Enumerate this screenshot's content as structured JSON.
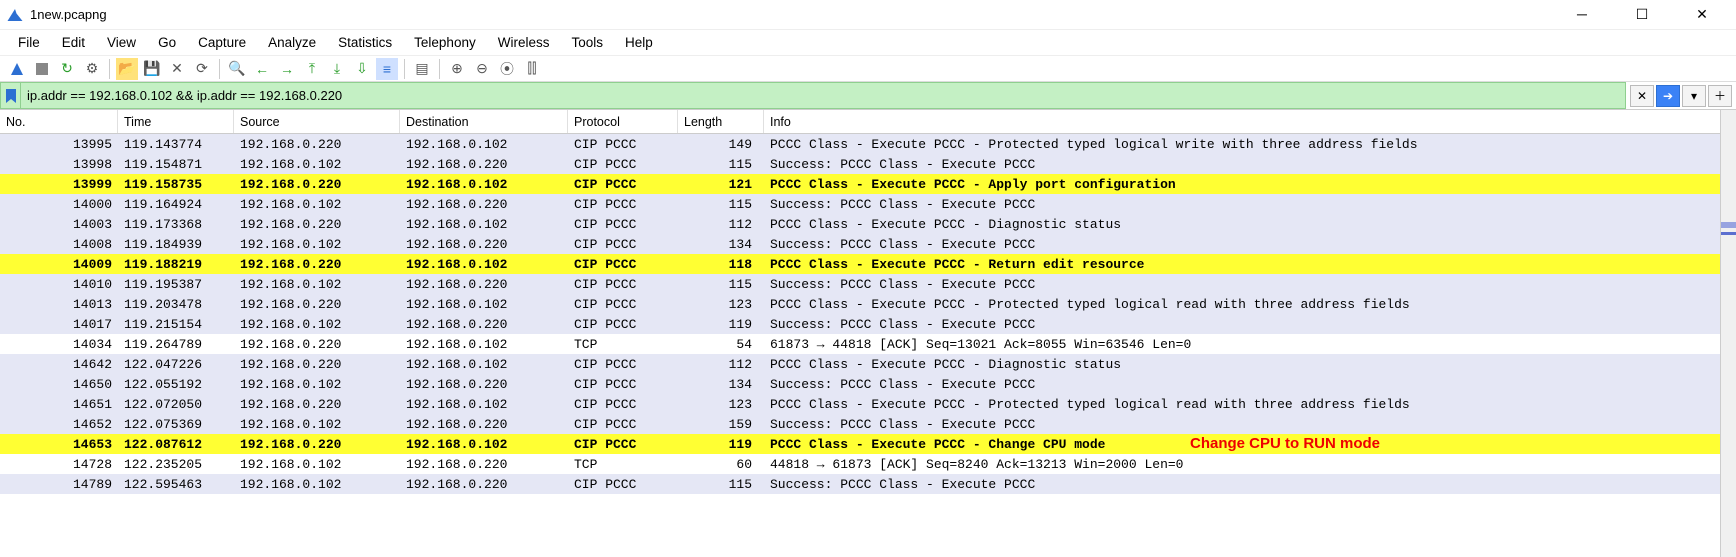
{
  "window": {
    "title": "1new.pcapng"
  },
  "menu": [
    "File",
    "Edit",
    "View",
    "Go",
    "Capture",
    "Analyze",
    "Statistics",
    "Telephony",
    "Wireless",
    "Tools",
    "Help"
  ],
  "filter": {
    "value": "ip.addr == 192.168.0.102 && ip.addr == 192.168.0.220"
  },
  "columns": {
    "no": "No.",
    "time": "Time",
    "source": "Source",
    "destination": "Destination",
    "protocol": "Protocol",
    "length": "Length",
    "info": "Info"
  },
  "annotation": {
    "text": "Change CPU to RUN mode",
    "row": 16
  },
  "rows": [
    {
      "no": "13995",
      "time": "119.143774",
      "src": "192.168.0.220",
      "dst": "192.168.0.102",
      "proto": "CIP PCCC",
      "len": "149",
      "info": "PCCC Class - Execute PCCC - Protected typed logical write with three address fields",
      "style": "lav"
    },
    {
      "no": "13998",
      "time": "119.154871",
      "src": "192.168.0.102",
      "dst": "192.168.0.220",
      "proto": "CIP PCCC",
      "len": "115",
      "info": "Success: PCCC Class - Execute PCCC",
      "style": "lav"
    },
    {
      "no": "13999",
      "time": "119.158735",
      "src": "192.168.0.220",
      "dst": "192.168.0.102",
      "proto": "CIP PCCC",
      "len": "121",
      "info": "PCCC Class - Execute PCCC - Apply port configuration",
      "style": "yellow"
    },
    {
      "no": "14000",
      "time": "119.164924",
      "src": "192.168.0.102",
      "dst": "192.168.0.220",
      "proto": "CIP PCCC",
      "len": "115",
      "info": "Success: PCCC Class - Execute PCCC",
      "style": "lav"
    },
    {
      "no": "14003",
      "time": "119.173368",
      "src": "192.168.0.220",
      "dst": "192.168.0.102",
      "proto": "CIP PCCC",
      "len": "112",
      "info": "PCCC Class - Execute PCCC - Diagnostic status",
      "style": "lav"
    },
    {
      "no": "14008",
      "time": "119.184939",
      "src": "192.168.0.102",
      "dst": "192.168.0.220",
      "proto": "CIP PCCC",
      "len": "134",
      "info": "Success: PCCC Class - Execute PCCC",
      "style": "lav"
    },
    {
      "no": "14009",
      "time": "119.188219",
      "src": "192.168.0.220",
      "dst": "192.168.0.102",
      "proto": "CIP PCCC",
      "len": "118",
      "info": "PCCC Class - Execute PCCC - Return edit resource",
      "style": "yellow"
    },
    {
      "no": "14010",
      "time": "119.195387",
      "src": "192.168.0.102",
      "dst": "192.168.0.220",
      "proto": "CIP PCCC",
      "len": "115",
      "info": "Success: PCCC Class - Execute PCCC",
      "style": "lav"
    },
    {
      "no": "14013",
      "time": "119.203478",
      "src": "192.168.0.220",
      "dst": "192.168.0.102",
      "proto": "CIP PCCC",
      "len": "123",
      "info": "PCCC Class - Execute PCCC - Protected typed logical read with three address fields",
      "style": "lav"
    },
    {
      "no": "14017",
      "time": "119.215154",
      "src": "192.168.0.102",
      "dst": "192.168.0.220",
      "proto": "CIP PCCC",
      "len": "119",
      "info": "Success: PCCC Class - Execute PCCC",
      "style": "lav"
    },
    {
      "no": "14034",
      "time": "119.264789",
      "src": "192.168.0.220",
      "dst": "192.168.0.102",
      "proto": "TCP",
      "len": "54",
      "info": "61873 → 44818 [ACK] Seq=13021 Ack=8055 Win=63546 Len=0",
      "style": "white"
    },
    {
      "no": "14642",
      "time": "122.047226",
      "src": "192.168.0.220",
      "dst": "192.168.0.102",
      "proto": "CIP PCCC",
      "len": "112",
      "info": "PCCC Class - Execute PCCC - Diagnostic status",
      "style": "lav"
    },
    {
      "no": "14650",
      "time": "122.055192",
      "src": "192.168.0.102",
      "dst": "192.168.0.220",
      "proto": "CIP PCCC",
      "len": "134",
      "info": "Success: PCCC Class - Execute PCCC",
      "style": "lav"
    },
    {
      "no": "14651",
      "time": "122.072050",
      "src": "192.168.0.220",
      "dst": "192.168.0.102",
      "proto": "CIP PCCC",
      "len": "123",
      "info": "PCCC Class - Execute PCCC - Protected typed logical read with three address fields",
      "style": "lav"
    },
    {
      "no": "14652",
      "time": "122.075369",
      "src": "192.168.0.102",
      "dst": "192.168.0.220",
      "proto": "CIP PCCC",
      "len": "159",
      "info": "Success: PCCC Class - Execute PCCC",
      "style": "lav"
    },
    {
      "no": "14653",
      "time": "122.087612",
      "src": "192.168.0.220",
      "dst": "192.168.0.102",
      "proto": "CIP PCCC",
      "len": "119",
      "info": "PCCC Class - Execute PCCC - Change CPU mode",
      "style": "yellow"
    },
    {
      "no": "14728",
      "time": "122.235205",
      "src": "192.168.0.102",
      "dst": "192.168.0.220",
      "proto": "TCP",
      "len": "60",
      "info": "44818 → 61873 [ACK] Seq=8240 Ack=13213 Win=2000 Len=0",
      "style": "white"
    },
    {
      "no": "14789",
      "time": "122.595463",
      "src": "192.168.0.102",
      "dst": "192.168.0.220",
      "proto": "CIP PCCC",
      "len": "115",
      "info": "Success: PCCC Class - Execute PCCC",
      "style": "lav"
    }
  ]
}
